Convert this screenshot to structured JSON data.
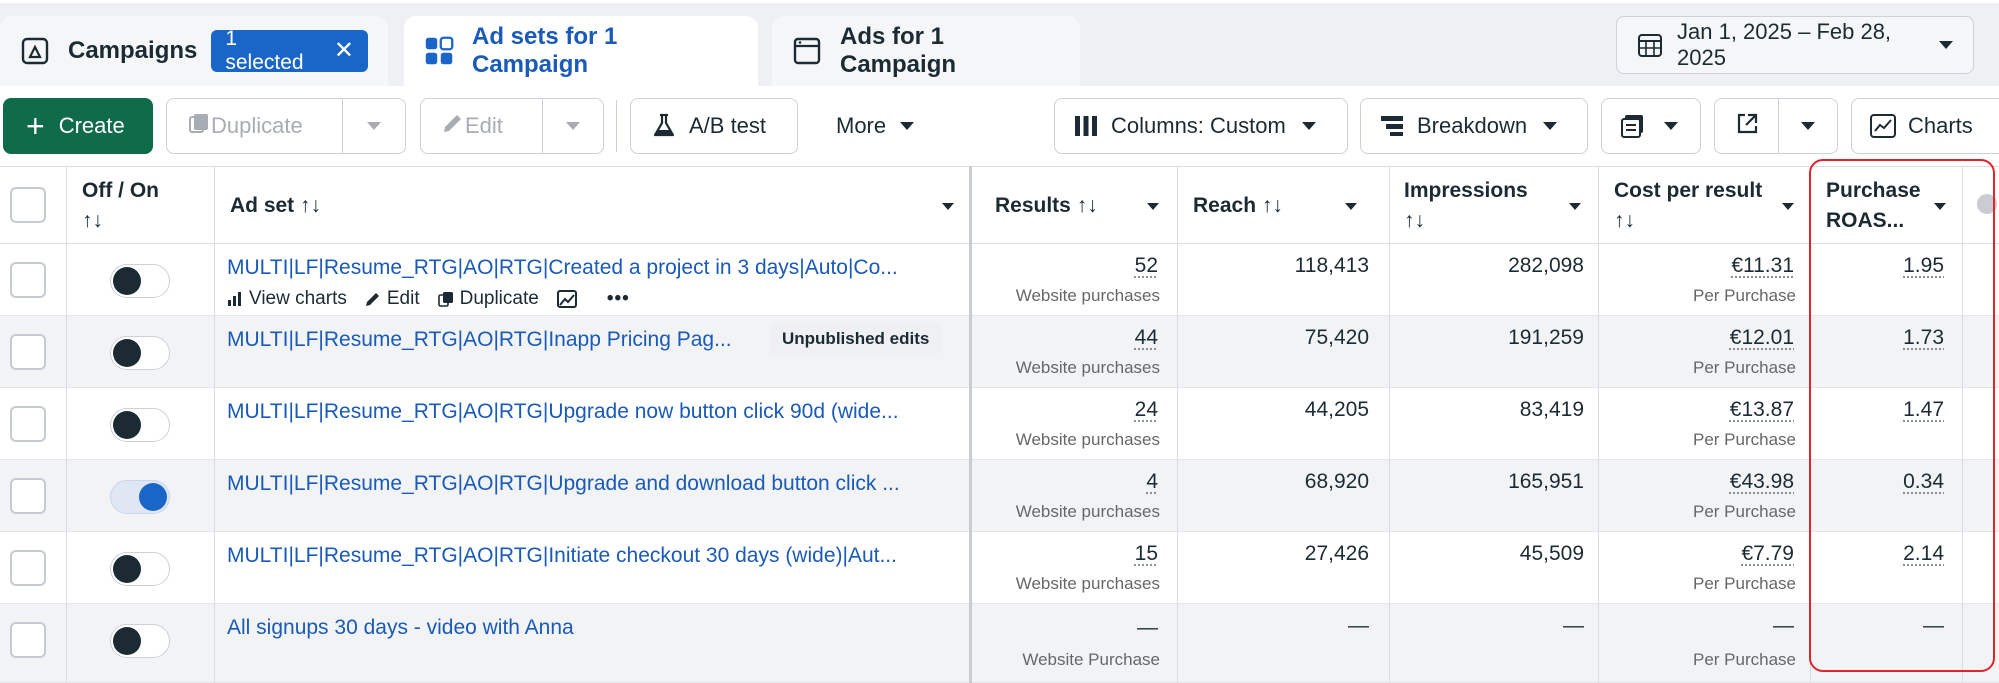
{
  "tabs": {
    "campaigns": {
      "label": "Campaigns",
      "chip": "1 selected",
      "chip_close": "✕"
    },
    "adsets": {
      "label": "Ad sets for 1 Campaign"
    },
    "ads": {
      "label": "Ads for 1 Campaign"
    }
  },
  "date_range": "Jan 1, 2025 – Feb 28, 2025",
  "toolbar": {
    "create": "Create",
    "duplicate": "Duplicate",
    "edit": "Edit",
    "ab_test": "A/B test",
    "more": "More",
    "columns": "Columns: Custom",
    "breakdown": "Breakdown",
    "charts": "Charts"
  },
  "columns": {
    "on_off": "Off / On",
    "adset": "Ad set",
    "results": "Results",
    "reach": "Reach",
    "impressions": "Impressions",
    "cost_per_result": "Cost per result",
    "roas_line1": "Purchase",
    "roas_line2": "ROAS...",
    "sort_glyph": "↑↓"
  },
  "row_actions": {
    "view_charts": "View charts",
    "edit": "Edit",
    "duplicate": "Duplicate",
    "more": "•••"
  },
  "rows": [
    {
      "name": "MULTI|LF|Resume_RTG|AO|RTG|Created a project in 3 days|Auto|Co...",
      "badge": "",
      "on": false,
      "results": "52",
      "results_sub": "Website purchases",
      "reach": "118,413",
      "impressions": "282,098",
      "cpr": "€11.31",
      "cpr_sub": "Per Purchase",
      "roas": "1.95"
    },
    {
      "name": "MULTI|LF|Resume_RTG|AO|RTG|Inapp Pricing Pag...",
      "badge": "Unpublished edits",
      "on": false,
      "results": "44",
      "results_sub": "Website purchases",
      "reach": "75,420",
      "impressions": "191,259",
      "cpr": "€12.01",
      "cpr_sub": "Per Purchase",
      "roas": "1.73"
    },
    {
      "name": "MULTI|LF|Resume_RTG|AO|RTG|Upgrade now button click 90d (wide...",
      "badge": "",
      "on": false,
      "results": "24",
      "results_sub": "Website purchases",
      "reach": "44,205",
      "impressions": "83,419",
      "cpr": "€13.87",
      "cpr_sub": "Per Purchase",
      "roas": "1.47"
    },
    {
      "name": "MULTI|LF|Resume_RTG|AO|RTG|Upgrade and download button click ...",
      "badge": "",
      "on": true,
      "results": "4",
      "results_sub": "Website purchases",
      "reach": "68,920",
      "impressions": "165,951",
      "cpr": "€43.98",
      "cpr_sub": "Per Purchase",
      "roas": "0.34"
    },
    {
      "name": "MULTI|LF|Resume_RTG|AO|RTG|Initiate checkout 30 days (wide)|Aut...",
      "badge": "",
      "on": false,
      "results": "15",
      "results_sub": "Website purchases",
      "reach": "27,426",
      "impressions": "45,509",
      "cpr": "€7.79",
      "cpr_sub": "Per Purchase",
      "roas": "2.14"
    },
    {
      "name": "All signups 30 days - video with Anna",
      "badge": "",
      "on": false,
      "results": "—",
      "results_sub": "Website Purchase",
      "reach": "—",
      "impressions": "—",
      "cpr": "—",
      "cpr_sub": "Per Purchase",
      "roas": "—"
    }
  ],
  "colors": {
    "accent_blue": "#1a5ab8",
    "create_green": "#0f6b4a",
    "highlight_red": "#e0242c",
    "toggle_on": "#1a66c8"
  },
  "icons": [
    "campaign-flag-icon",
    "grid-icon",
    "window-icon",
    "calendar-icon",
    "plus-icon",
    "copy-icon",
    "pencil-icon",
    "flask-icon",
    "columns-icon",
    "breakdown-icon",
    "reports-icon",
    "export-icon",
    "chart-line-icon",
    "bar-chart-icon",
    "image-icon",
    "sort-icon"
  ]
}
